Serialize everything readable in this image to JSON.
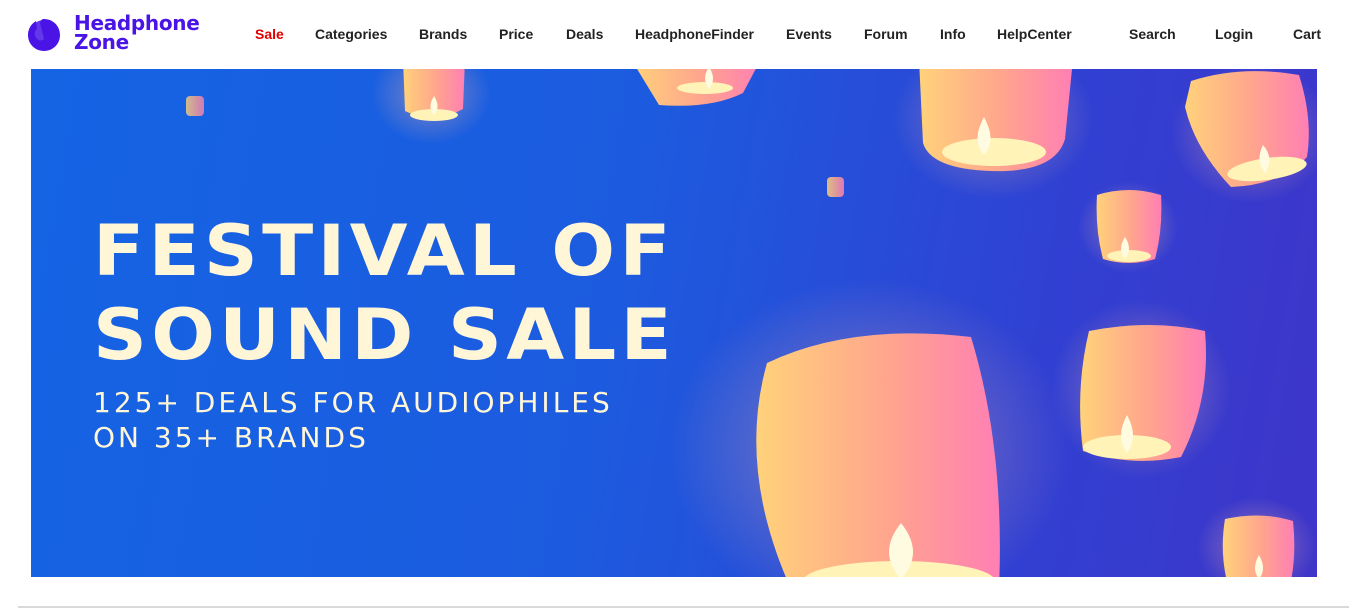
{
  "logo": {
    "line1": "Headphone",
    "line2": "Zone",
    "icon": "headphone-zone-logo-icon",
    "color": "#4a14e6"
  },
  "nav": {
    "items": [
      {
        "label": "Sale",
        "highlight": true
      },
      {
        "label": "Categories"
      },
      {
        "label": "Brands"
      },
      {
        "label": "Price"
      },
      {
        "label": "Deals"
      },
      {
        "label": "HeadphoneFinder"
      },
      {
        "label": "Events"
      },
      {
        "label": "Forum"
      },
      {
        "label": "Info"
      },
      {
        "label": "HelpCenter"
      }
    ],
    "utility": [
      {
        "label": "Search"
      },
      {
        "label": "Login"
      },
      {
        "label": "Cart"
      }
    ],
    "sale_color": "#e00000"
  },
  "hero": {
    "title_line1": "FESTIVAL OF",
    "title_line2": "SOUND SALE",
    "subtitle_line1": "125+ DEALS FOR AUDIOPHILES",
    "subtitle_line2": "ON 35+ BRANDS",
    "background_colors": [
      "#1464e4",
      "#3e35c9"
    ],
    "text_color": "#fff6d8",
    "decoration": "sky-lantern-illustrations"
  }
}
